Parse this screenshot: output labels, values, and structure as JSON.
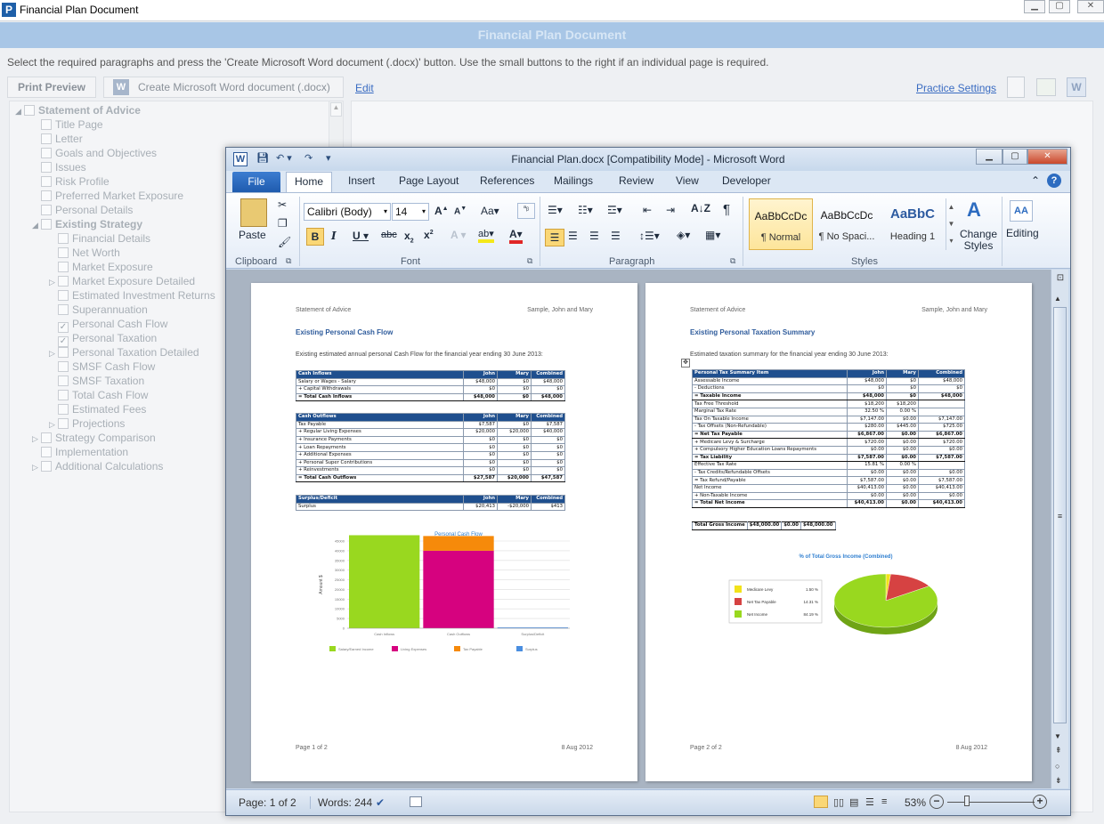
{
  "app": {
    "title": "Financial Plan Document",
    "logo_letter": "P",
    "banner": "Financial Plan Document",
    "instructions": "Select the required paragraphs and press the 'Create Microsoft Word document (.docx)' button. Use the small buttons to the right if an individual page is required.",
    "print_preview": "Print Preview",
    "create_docx": "Create Microsoft Word document (.docx)",
    "edit": "Edit",
    "practice_settings": "Practice Settings"
  },
  "tree": [
    {
      "label": "Statement of Advice",
      "checked": false,
      "expander": "◢",
      "bold": true
    },
    {
      "label": "Title Page",
      "checked": false,
      "expander": "",
      "bold": false
    },
    {
      "label": "Letter",
      "checked": false,
      "expander": "",
      "bold": false
    },
    {
      "label": "Goals and Objectives",
      "checked": false,
      "expander": "",
      "bold": false
    },
    {
      "label": "Issues",
      "checked": false,
      "expander": "",
      "bold": false
    },
    {
      "label": "Risk Profile",
      "checked": false,
      "expander": "",
      "bold": false
    },
    {
      "label": "Preferred Market Exposure",
      "checked": false,
      "expander": "",
      "bold": false
    },
    {
      "label": "Personal Details",
      "checked": false,
      "expander": "",
      "bold": false
    },
    {
      "label": "Existing Strategy",
      "checked": false,
      "expander": "◢",
      "bold": true
    },
    {
      "label": "Financial Details",
      "checked": false,
      "expander": "",
      "bold": false
    },
    {
      "label": "Net Worth",
      "checked": false,
      "expander": "",
      "bold": false
    },
    {
      "label": "Market Exposure",
      "checked": false,
      "expander": "",
      "bold": false
    },
    {
      "label": "Market Exposure Detailed",
      "checked": false,
      "expander": "▷",
      "bold": false
    },
    {
      "label": "Estimated Investment Returns",
      "checked": false,
      "expander": "",
      "bold": false
    },
    {
      "label": "Superannuation",
      "checked": false,
      "expander": "",
      "bold": false
    },
    {
      "label": "Personal Cash Flow",
      "checked": true,
      "expander": "",
      "bold": false
    },
    {
      "label": "Personal Taxation",
      "checked": true,
      "expander": "",
      "bold": false
    },
    {
      "label": "Personal Taxation Detailed",
      "checked": false,
      "expander": "▷",
      "bold": false
    },
    {
      "label": "SMSF Cash Flow",
      "checked": false,
      "expander": "",
      "bold": false
    },
    {
      "label": "SMSF Taxation",
      "checked": false,
      "expander": "",
      "bold": false
    },
    {
      "label": "Total Cash Flow",
      "checked": false,
      "expander": "",
      "bold": false
    },
    {
      "label": "Estimated Fees",
      "checked": false,
      "expander": "",
      "bold": false
    },
    {
      "label": "Projections",
      "checked": false,
      "expander": "▷",
      "bold": false
    },
    {
      "label": "Strategy Comparison",
      "checked": false,
      "expander": "▷",
      "bold": false
    },
    {
      "label": "Implementation",
      "checked": false,
      "expander": "",
      "bold": false
    },
    {
      "label": "Additional Calculations",
      "checked": false,
      "expander": "▷",
      "bold": false
    }
  ],
  "word": {
    "title": "Financial Plan.docx [Compatibility Mode]  -  Microsoft Word",
    "tabs": [
      "File",
      "Home",
      "Insert",
      "Page Layout",
      "References",
      "Mailings",
      "Review",
      "View",
      "Developer"
    ],
    "font_name": "Calibri (Body)",
    "font_size": "14",
    "paste": "Paste",
    "change_styles": "Change Styles",
    "editing": "Editing",
    "groups": [
      "Clipboard",
      "Font",
      "Paragraph",
      "Styles"
    ],
    "styles": [
      {
        "preview": "AaBbCcDc",
        "name": "¶ Normal"
      },
      {
        "preview": "AaBbCcDc",
        "name": "¶ No Spaci..."
      },
      {
        "preview": "AaBbC",
        "name": "Heading 1"
      }
    ],
    "status": {
      "page": "Page: 1 of 2",
      "words": "Words: 244",
      "zoom": "53%"
    }
  },
  "page1": {
    "header_left": "Statement of Advice",
    "header_right": "Sample, John and Mary",
    "title": "Existing Personal Cash Flow",
    "subtitle": "Existing estimated annual personal Cash Flow for the financial year ending 30 June 2013:",
    "footer_left": "Page 1 of 2",
    "footer_right": "8 Aug 2012",
    "tables": [
      {
        "cols": [
          "Cash Inflows",
          "John",
          "Mary",
          "Combined"
        ],
        "rows": [
          [
            "Salary or Wages - Salary",
            "$48,000",
            "$0",
            "$48,000"
          ],
          [
            "+ Capital Withdrawals",
            "$0",
            "$0",
            "$0"
          ],
          [
            "= Total Cash Inflows",
            "$48,000",
            "$0",
            "$48,000"
          ]
        ]
      },
      {
        "cols": [
          "Cash Outflows",
          "John",
          "Mary",
          "Combined"
        ],
        "rows": [
          [
            "Tax Payable",
            "$7,587",
            "$0",
            "$7,587"
          ],
          [
            "+ Regular Living Expenses",
            "$20,000",
            "$20,000",
            "$40,000"
          ],
          [
            "+ Insurance Payments",
            "$0",
            "$0",
            "$0"
          ],
          [
            "+ Loan Repayments",
            "$0",
            "$0",
            "$0"
          ],
          [
            "+ Additional Expenses",
            "$0",
            "$0",
            "$0"
          ],
          [
            "+ Personal Super Contributions",
            "$0",
            "$0",
            "$0"
          ],
          [
            "+ Reinvestments",
            "$0",
            "$0",
            "$0"
          ],
          [
            "= Total Cash Outflows",
            "$27,587",
            "$20,000",
            "$47,587"
          ]
        ]
      },
      {
        "cols": [
          "Surplus/Deficit",
          "John",
          "Mary",
          "Combined"
        ],
        "rows": [
          [
            "Surplus",
            "$20,413",
            "-$20,000",
            "$413"
          ]
        ]
      }
    ],
    "chart_data": {
      "type": "bar",
      "title": "Personal Cash Flow",
      "ylabel": "Amount $",
      "categories": [
        "Cash Inflows",
        "Cash Outflows",
        "Surplus/Deficit"
      ],
      "ylim": [
        0,
        45000
      ],
      "yticks": [
        "0",
        "5000",
        "10000",
        "15000",
        "20000",
        "25000",
        "30000",
        "35000",
        "40000",
        "45000"
      ],
      "series": [
        {
          "name": "Salary/Earned Income",
          "color": "#99d81f",
          "values": [
            48000,
            0,
            0
          ]
        },
        {
          "name": "Living Expenses",
          "color": "#d6027f",
          "values": [
            0,
            40000,
            0
          ]
        },
        {
          "name": "Tax Payable",
          "color": "#f68a0a",
          "values": [
            0,
            7587,
            0
          ]
        },
        {
          "name": "Surplus",
          "color": "#4a8ee0",
          "values": [
            0,
            0,
            413
          ]
        }
      ]
    }
  },
  "page2": {
    "header_left": "Statement of Advice",
    "header_right": "Sample, John and Mary",
    "title": "Existing Personal Taxation Summary",
    "subtitle": "Estimated taxation summary for the financial year ending 30 June 2013:",
    "footer_left": "Page 2 of 2",
    "footer_right": "8 Aug 2012",
    "table": {
      "cols": [
        "Personal Tax Summary Item",
        "John",
        "Mary",
        "Combined"
      ],
      "rows": [
        [
          "Assessable Income",
          "$48,000",
          "$0",
          "$48,000"
        ],
        [
          "- Deductions",
          "$0",
          "$0",
          "$0"
        ],
        [
          "= Taxable Income",
          "$48,000",
          "$0",
          "$48,000"
        ],
        [
          "Tax Free Threshold",
          "$18,200",
          "$18,200",
          ""
        ],
        [
          "Marginal Tax Rate",
          "32.50 %",
          "0.00 %",
          ""
        ],
        [
          "Tax On Taxable Income",
          "$7,147.00",
          "$0.00",
          "$7,147.00"
        ],
        [
          "- Tax Offsets (Non-Refundable)",
          "$280.00",
          "$445.00",
          "$725.00"
        ],
        [
          "= Net Tax Payable",
          "$6,867.00",
          "$0.00",
          "$6,867.00"
        ],
        [
          "+ Medicare Levy & Surcharge",
          "$720.00",
          "$0.00",
          "$720.00"
        ],
        [
          "+ Compulsory Higher Education Loans Repayments",
          "$0.00",
          "$0.00",
          "$0.00"
        ],
        [
          "= Tax Liability",
          "$7,587.00",
          "$0.00",
          "$7,587.00"
        ],
        [
          "Effective Tax Rate",
          "15.81 %",
          "0.00 %",
          ""
        ],
        [
          "- Tax Credits/Refundable Offsets",
          "$0.00",
          "$0.00",
          "$0.00"
        ],
        [
          "= Tax Refund/Payable",
          "$7,587.00",
          "$0.00",
          "$7,587.00"
        ],
        [
          "Net Income",
          "$40,413.00",
          "$0.00",
          "$40,413.00"
        ],
        [
          "+ Non-Taxable Income",
          "$0.00",
          "$0.00",
          "$0.00"
        ],
        [
          "= Total Net Income",
          "$40,413.00",
          "$0.00",
          "$40,413.00"
        ]
      ]
    },
    "gross": [
      "Total Gross Income",
      "$48,000.00",
      "$0.00",
      "$48,000.00"
    ],
    "chart_data": {
      "type": "pie",
      "title": "% of Total Gross Income (Combined)",
      "slices": [
        {
          "name": "Medicare Levy",
          "label": "1.50 %",
          "value": 1.5,
          "color": "#f2e21a"
        },
        {
          "name": "Net Tax Payable",
          "label": "14.31 %",
          "value": 14.31,
          "color": "#d64242"
        },
        {
          "name": "Net Income",
          "label": "84.19 %",
          "value": 84.19,
          "color": "#99d81f"
        }
      ]
    }
  }
}
